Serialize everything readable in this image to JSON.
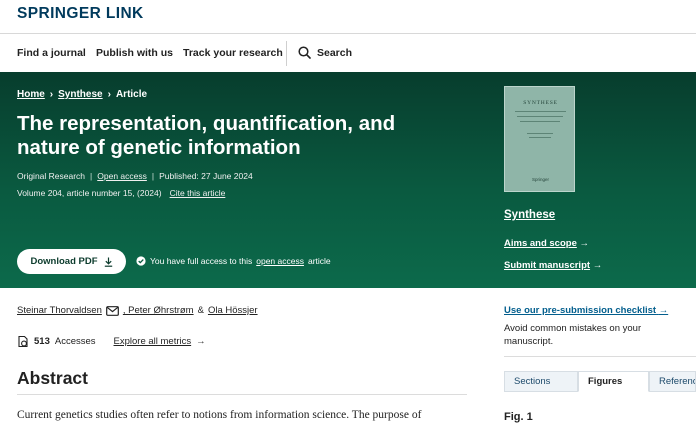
{
  "header": {
    "logo": "SPRINGER LINK"
  },
  "nav": {
    "links": [
      "Find a journal",
      "Publish with us",
      "Track your research"
    ],
    "search_label": "Search"
  },
  "breadcrumb": {
    "home": "Home",
    "journal": "Synthese",
    "current": "Article"
  },
  "article": {
    "title": "The representation, quantification, and nature of genetic information",
    "type": "Original Research",
    "access": "Open access",
    "published": "Published: 27 June 2024",
    "volume": "Volume 204, article number 15, (2024)",
    "cite": "Cite this article",
    "pdf_button": "Download PDF",
    "access_note_prefix": "You have full access to this",
    "access_note_link": "open access",
    "access_note_suffix": "article"
  },
  "journal": {
    "cover_title": "SYNTHESE",
    "cover_publisher": "Springer",
    "name": "Synthese",
    "aims": "Aims and scope",
    "submit": "Submit manuscript"
  },
  "authors": {
    "first": "Steinar Thorvaldsen",
    "rest_1": ", Peter Øhrstrøm",
    "amp": "&",
    "last": "Ola Hössjer"
  },
  "metrics": {
    "count": "513",
    "label": "Accesses",
    "link": "Explore all metrics"
  },
  "abstract": {
    "heading": "Abstract",
    "text": "Current genetics studies often refer to notions from information science. The purpose of"
  },
  "sidebar": {
    "checklist_link": "Use our pre-submission checklist",
    "checklist_desc": "Avoid common mistakes on your manuscript.",
    "tabs": [
      "Sections",
      "Figures",
      "References"
    ],
    "figure_label": "Fig. 1"
  },
  "colors": {
    "hero_green": "#0a5a40",
    "link_blue": "#025e8d",
    "logo_navy": "#003a5c"
  }
}
